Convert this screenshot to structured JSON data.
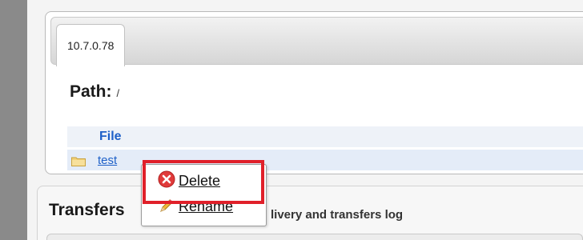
{
  "tab": {
    "label": "10.7.0.78"
  },
  "path": {
    "label": "Path:",
    "value": "/"
  },
  "file_table": {
    "header": "File",
    "rows": [
      {
        "name": "test",
        "icon": "folder-icon"
      }
    ]
  },
  "context_menu": {
    "items": [
      {
        "label": "Delete",
        "icon": "delete-icon"
      },
      {
        "label": "Rename",
        "icon": "pencil-icon"
      }
    ]
  },
  "transfers": {
    "title": "Transfers",
    "subtitle": "livery and transfers log"
  },
  "colors": {
    "accent_link": "#1e60c8",
    "highlight": "#e0202a",
    "delete_red": "#e03a3a"
  }
}
